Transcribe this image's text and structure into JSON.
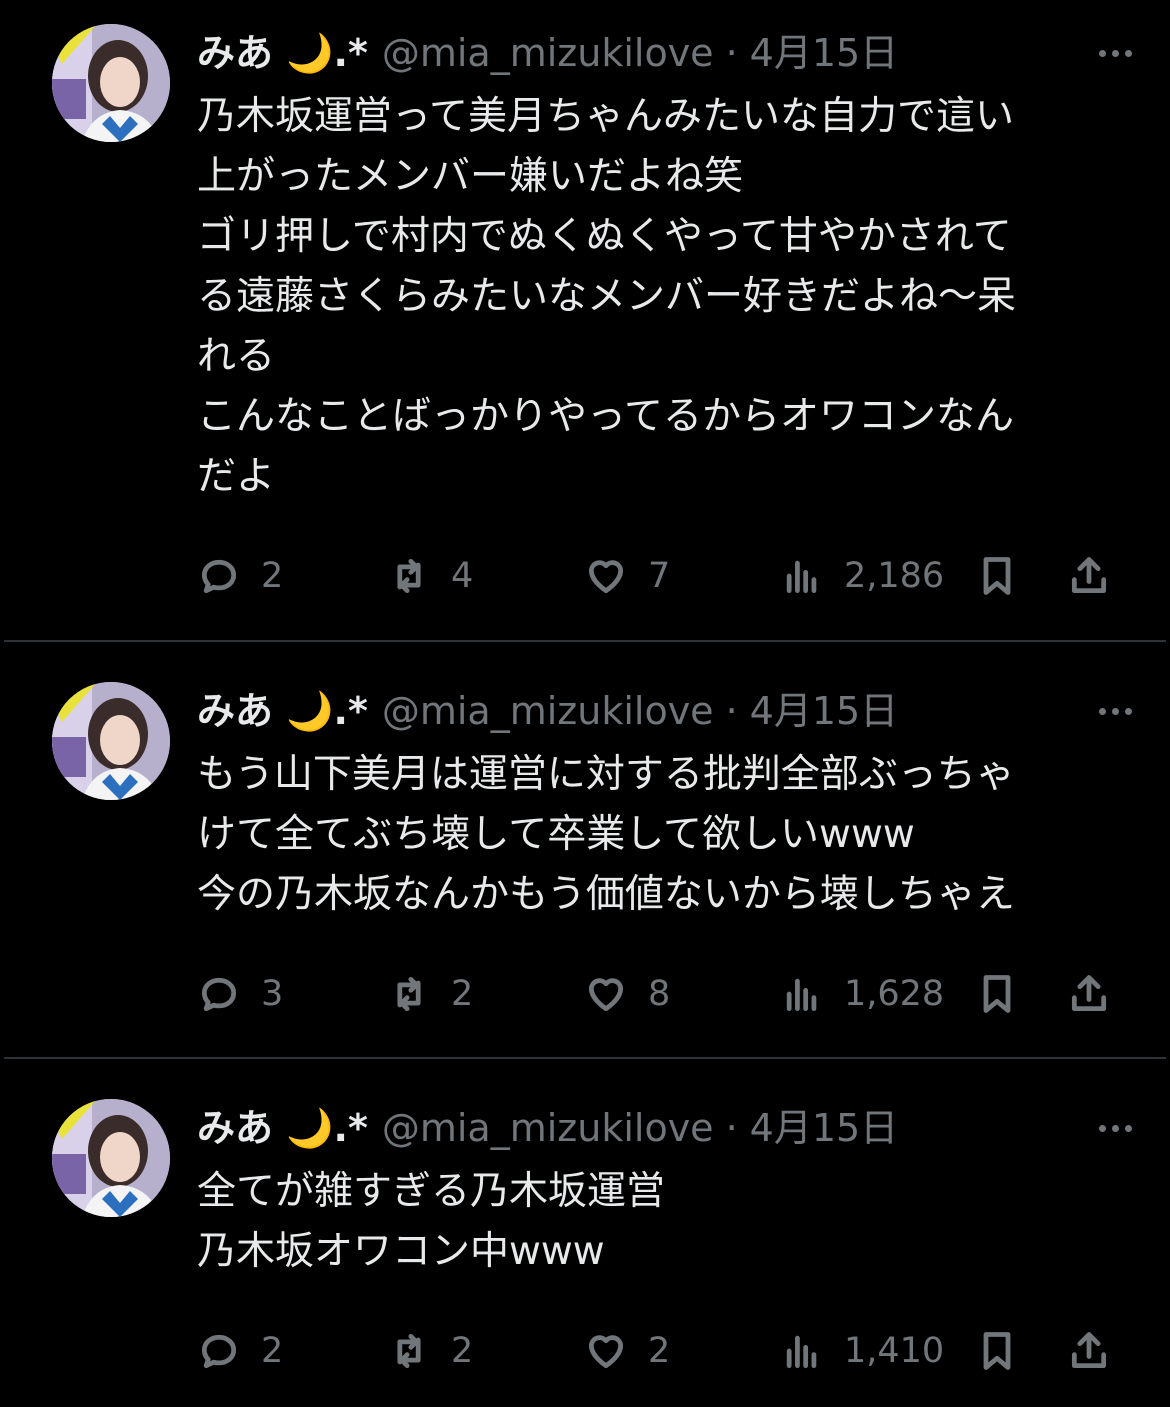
{
  "tweets": [
    {
      "name": "みあ 🌙.*",
      "handle": "@mia_mizukilove",
      "separator": "·",
      "date": "4月15日",
      "text": "乃木坂運営って美月ちゃんみたいな自力で這い\n上がったメンバー嫌いだよね笑\nゴリ押しで村内でぬくぬくやって甘やかされて\nる遠藤さくらみたいなメンバー好きだよね〜呆\nれる\nこんなことばっかりやってるからオワコンなん\nだよ",
      "replies": "2",
      "retweets": "4",
      "likes": "7",
      "views": "2,186"
    },
    {
      "name": "みあ 🌙.*",
      "handle": "@mia_mizukilove",
      "separator": "·",
      "date": "4月15日",
      "text": "もう山下美月は運営に対する批判全部ぶっちゃ\nけて全てぶち壊して卒業して欲しいwww\n今の乃木坂なんかもう価値ないから壊しちゃえ",
      "replies": "3",
      "retweets": "2",
      "likes": "8",
      "views": "1,628"
    },
    {
      "name": "みあ 🌙.*",
      "handle": "@mia_mizukilove",
      "separator": "·",
      "date": "4月15日",
      "text": "全てが雑すぎる乃木坂運営\n乃木坂オワコン中www",
      "replies": "2",
      "retweets": "2",
      "likes": "2",
      "views": "1,410"
    }
  ],
  "icons": {
    "reply": "reply-icon",
    "retweet": "retweet-icon",
    "like": "heart-icon",
    "views": "views-icon",
    "bookmark": "bookmark-icon",
    "share": "share-icon",
    "more": "more-icon"
  },
  "colors": {
    "background": "#000000",
    "text": "#e7e9ea",
    "muted": "#71767b",
    "divider": "#2f3336"
  }
}
